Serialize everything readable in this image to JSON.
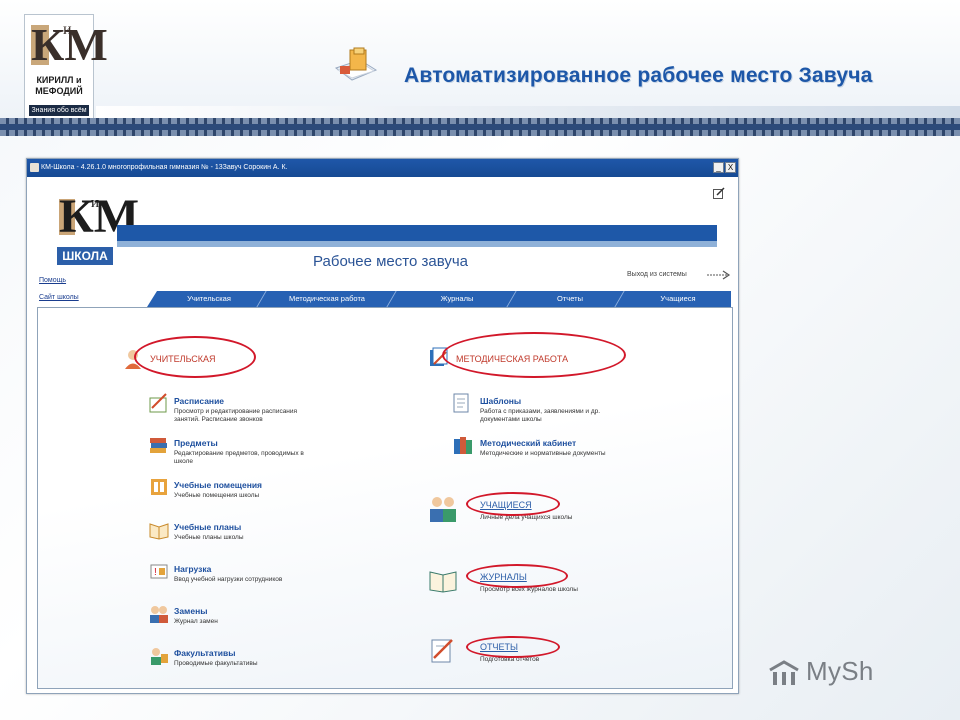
{
  "slide": {
    "title": "Автоматизированное рабочее место Завуча",
    "logo": {
      "letters_main": "КМ",
      "letters_small": "и",
      "name": "КИРИЛЛ и МЕФОДИЙ",
      "slogan": "Знания обо всём"
    },
    "watermark": "MySh"
  },
  "window": {
    "title": "КМ-Школа - 4.26.1.0 многопрофильная гимназия № - 13Завуч Сорокин А. К.",
    "controls": {
      "minimize": "_",
      "close": "X"
    },
    "logo": {
      "letters_main": "КМ",
      "letters_small": "и",
      "school": "ШКОЛА"
    },
    "heading": "Рабочее место завуча",
    "logout": "Выход из системы",
    "side_links": [
      "Помощь",
      "Сайт школы"
    ],
    "tabs": [
      "Учительская",
      "Методическая работа",
      "Журналы",
      "Отчеты",
      "Учащиеся"
    ]
  },
  "sections": {
    "teacher": {
      "label": "УЧИТЕЛЬСКАЯ",
      "items": [
        {
          "title": "Расписание",
          "desc": "Просмотр и редактирование расписания занятий. Расписание звонков"
        },
        {
          "title": "Предметы",
          "desc": "Редактирование предметов, проводимых в школе"
        },
        {
          "title": "Учебные помещения",
          "desc": "Учебные помещения школы"
        },
        {
          "title": "Учебные планы",
          "desc": "Учебные планы школы"
        },
        {
          "title": "Нагрузка",
          "desc": "Ввод учебной нагрузки сотрудников"
        },
        {
          "title": "Замены",
          "desc": "Журнал замен"
        },
        {
          "title": "Факультативы",
          "desc": "Проводимые факультативы"
        }
      ]
    },
    "method": {
      "label": "МЕТОДИЧЕСКАЯ РАБОТА",
      "items": [
        {
          "title": "Шаблоны",
          "desc": "Работа с приказами, заявлениями и др. документами школы"
        },
        {
          "title": "Методический кабинет",
          "desc": "Методические и нормативные документы"
        }
      ]
    },
    "students": {
      "label": "УЧАЩИЕСЯ",
      "desc": "Личные дела учащихся школы"
    },
    "journals": {
      "label": "ЖУРНАЛЫ",
      "desc": "Просмотр всех журналов школы"
    },
    "reports": {
      "label": "ОТЧЕТЫ",
      "desc": "Подготовка отчетов"
    }
  },
  "colors": {
    "accent": "#1d57a8",
    "highlight_oval": "#d2182a",
    "tab_bar": "#2761b3"
  }
}
